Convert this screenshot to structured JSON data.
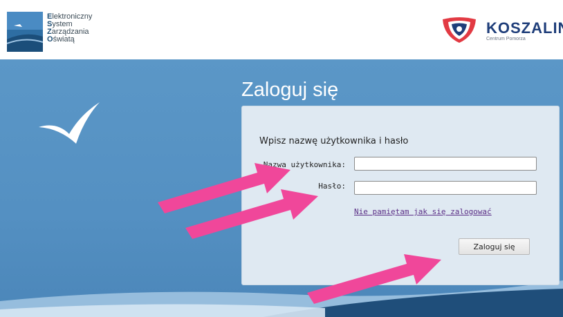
{
  "header": {
    "esz_logo_lines": [
      {
        "first": "E",
        "rest": "lektroniczny"
      },
      {
        "first": "S",
        "rest": "ystem"
      },
      {
        "first": "Z",
        "rest": "arządzania"
      },
      {
        "first": "O",
        "rest": "światą"
      }
    ],
    "city_name": "KOSZALIN",
    "city_tagline": "Centrum Pomorza"
  },
  "login": {
    "title": "Zaloguj się",
    "heading": "Wpisz nazwę użytkownika i hasło",
    "username_label": "Nazwa użytkownika:",
    "username_value": "",
    "password_label": "Hasło:",
    "password_value": "",
    "forgot_link": "Nie pamiętam jak się zalogować",
    "submit_label": "Zaloguj się"
  },
  "colors": {
    "band_blue": "#5490c2",
    "panel": "#dfe9f2",
    "annotation_arrows": "#f0479a",
    "link": "#5b2f86"
  },
  "icons": {
    "esz_logo": "esz-sail-logo",
    "city_logo": "koszalin-crest-logo",
    "decoration": "checkmark-bird-icon"
  }
}
